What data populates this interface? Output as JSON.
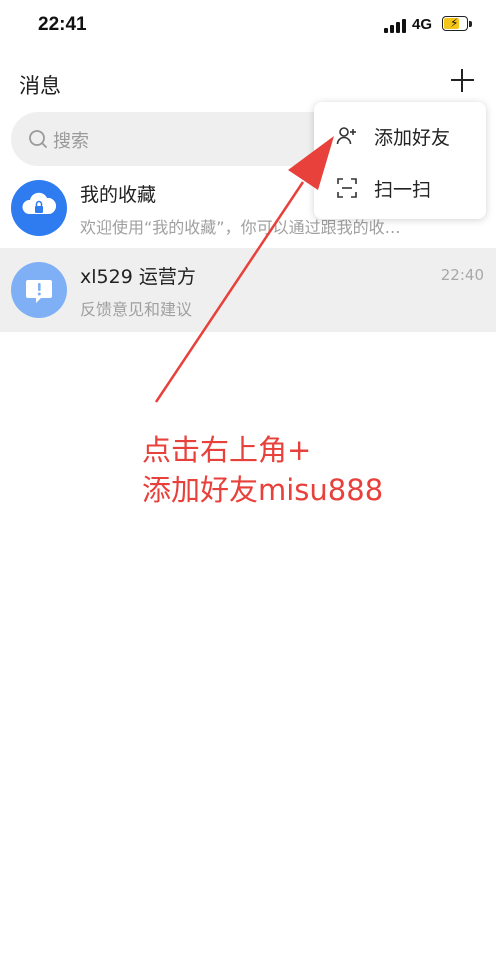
{
  "status_bar": {
    "time": "22:41",
    "network": "4G"
  },
  "header": {
    "title": "消息",
    "add_icon": "plus-icon"
  },
  "search": {
    "placeholder": "搜索"
  },
  "conversations": [
    {
      "title": "我的收藏",
      "subtitle": "欢迎使用“我的收藏”，你可以通过跟我的收…",
      "time": "",
      "avatar_color": "#2f7bf0",
      "icon": "cloud-lock-icon"
    },
    {
      "title": "xl529 运营方",
      "subtitle": "反馈意见和建议",
      "time": "22:40",
      "avatar_color": "#7fb0f5",
      "icon": "feedback-icon"
    }
  ],
  "dropdown_menu": {
    "items": [
      {
        "label": "添加好友",
        "icon": "add-friend-icon"
      },
      {
        "label": "扫一扫",
        "icon": "scan-icon"
      }
    ]
  },
  "annotation": {
    "line1": "点击右上角+",
    "line2": "添加好友misu888",
    "color": "#e8403b"
  }
}
